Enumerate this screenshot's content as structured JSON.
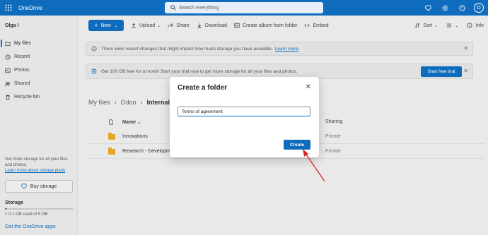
{
  "app": {
    "title": "OneDrive"
  },
  "search": {
    "placeholder": "Search everything"
  },
  "user": {
    "name": "Olga I",
    "avatar": "O"
  },
  "sidebar": {
    "items": [
      {
        "label": "My files",
        "icon": "folder-icon",
        "active": true
      },
      {
        "label": "Recent",
        "icon": "clock-icon"
      },
      {
        "label": "Photos",
        "icon": "image-icon"
      },
      {
        "label": "Shared",
        "icon": "people-icon"
      },
      {
        "label": "Recycle bin",
        "icon": "trash-icon"
      }
    ],
    "storage_note": "Get more storage for all your files and photos.",
    "storage_link": "Learn more about storage plans",
    "buy_storage": "Buy storage",
    "storage_label": "Storage",
    "storage_used": "< 0.1 GB used of 5 GB",
    "storage_fraction": 0.02,
    "get_apps": "Get the OneDrive apps"
  },
  "cmdbar": {
    "new_label": "New",
    "upload": "Upload",
    "share": "Share",
    "download": "Download",
    "create_album": "Create album from folder",
    "embed": "Embed",
    "sort": "Sort",
    "view": "",
    "info": "Info"
  },
  "banners": {
    "changes_text": "There were recent changes that might impact how much storage you have available.",
    "changes_link": "Learn more",
    "trial_text": "Get 100 GB free for a month    Start your trial now to get more storage for all your files and photos.",
    "trial_button": "Start free trial"
  },
  "breadcrumb": [
    "My files",
    "Odoo",
    "Internal P"
  ],
  "table": {
    "col_name": "Name",
    "col_sharing": "Sharing",
    "rows": [
      {
        "name": "Innovations",
        "sharing": "Private"
      },
      {
        "name": "Research - Developme",
        "sharing": "Private"
      }
    ]
  },
  "dialog": {
    "title": "Create a folder",
    "input_value": "Terms of agreement",
    "create_label": "Create"
  },
  "colors": {
    "brand": "#0f6cbd",
    "arrow": "#d62828",
    "folder": "#e5a625"
  }
}
